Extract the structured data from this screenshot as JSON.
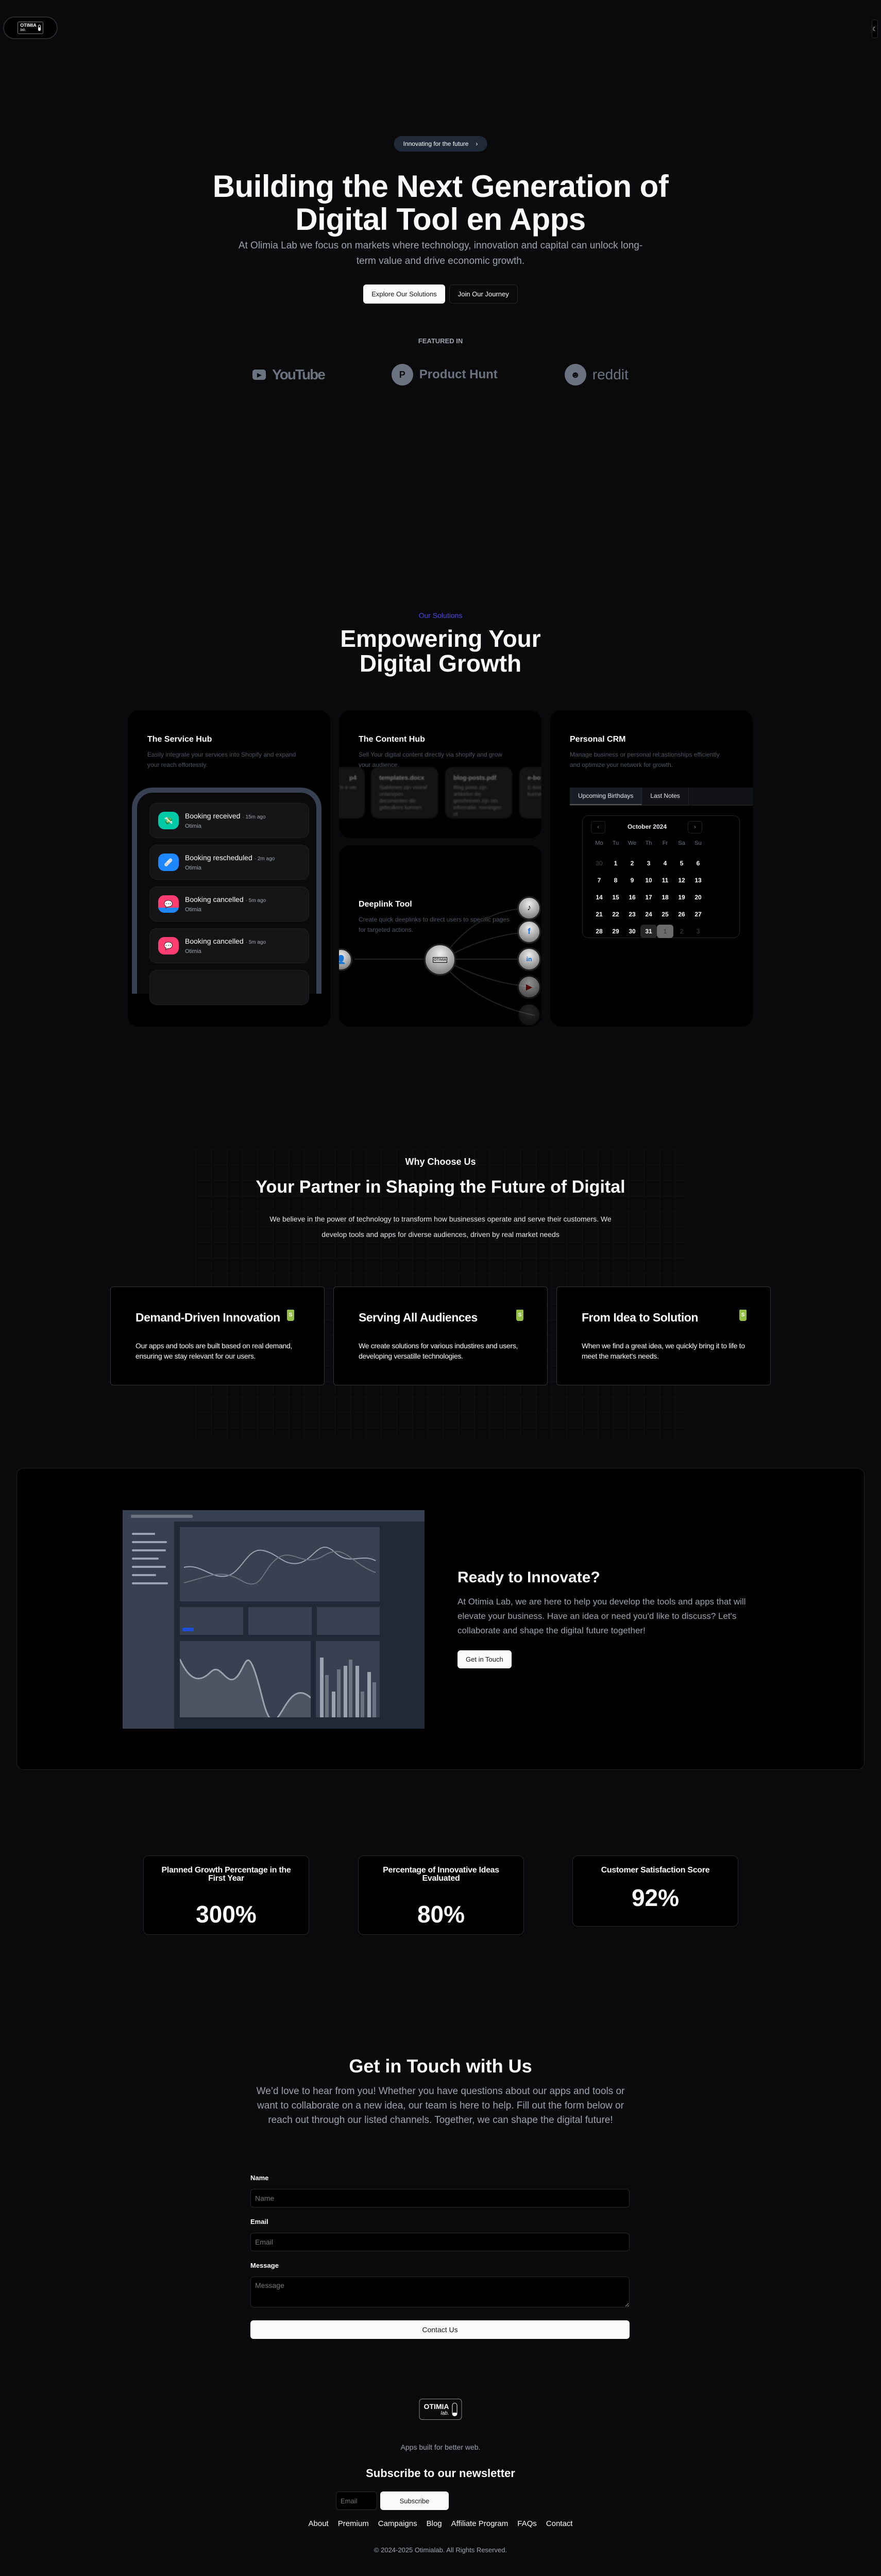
{
  "header": {
    "logo_main": "OTIMIA",
    "logo_sub": "lab.",
    "theme_icon": "moon-icon"
  },
  "hero": {
    "badge": "Innovating for the future",
    "badge_icon": "›",
    "title_line1": "Building the Next Generation of",
    "title_line2": "Digital Tool en Apps",
    "subtitle": "At Olimia Lab we focus on markets where technology, innovation and capital can unlock long-term value and drive economic growth.",
    "primary_button": "Explore Our Solutions",
    "secondary_button": "Join Our Journey",
    "featured_label": "FEATURED IN",
    "featured_logos": [
      "YouTube",
      "Product Hunt",
      "reddit"
    ]
  },
  "solutions": {
    "label": "Our Solutions",
    "title_line1": "Empowering Your",
    "title_line2": "Digital Growth",
    "service_hub": {
      "title": "The Service Hub",
      "desc": "Easily integrate your services into Shopify and expand your reach effortessly.",
      "notifications": [
        {
          "title": "Booking received",
          "time": "· 15m ago",
          "sub": "Otimia",
          "color": "#00c9a7",
          "icon": "💸"
        },
        {
          "title": "Booking rescheduled",
          "time": "· 2m ago",
          "sub": "Otimia",
          "color": "#1e86ff",
          "icon": "🩹"
        },
        {
          "title": "Booking cancelled",
          "time": "· 5m ago",
          "sub": "Otimia",
          "color": "#ff3d71",
          "icon": "💬"
        },
        {
          "title": "Booking cancelled",
          "time": "· 5m ago",
          "sub": "Otimia",
          "color": "#ff3d71",
          "icon": "💬"
        }
      ]
    },
    "content_hub": {
      "title": "The Content Hub",
      "desc": "Sell Your digital content directly via shopify and grow your audience.",
      "files": [
        {
          "name": "p4",
          "desc": "ls e ver"
        },
        {
          "name": "templates.docx",
          "desc": "Sjablonen zijn vooraf ontworpen documenten die gebruikers kunnen"
        },
        {
          "name": "blog-posts.pdf",
          "desc": "Blog posts zijn artikelen die geschreven zijn om informatie, meningen of"
        },
        {
          "name": "e-bo",
          "desc": "E-boo digita die g kunne"
        }
      ]
    },
    "deeplink": {
      "title": "Deeplink Tool",
      "desc": "Create quick deeplinks to direct users to specific pages for targeted actions.",
      "targets": [
        "tiktok",
        "facebook",
        "linkedin",
        "youtube",
        "instagram"
      ]
    },
    "crm": {
      "title": "Personal CRM",
      "desc": "Manage business or personal rel;astionships efficiently and optimize your network for growth.",
      "tabs": [
        "Upcoming Birthdays",
        "Last Notes"
      ],
      "calendar": {
        "month": "October 2024",
        "weekdays": [
          "Mo",
          "Tu",
          "We",
          "Th",
          "Fr",
          "Sa",
          "Su"
        ],
        "days": [
          "30",
          "1",
          "2",
          "3",
          "4",
          "5",
          "6",
          "7",
          "8",
          "9",
          "10",
          "11",
          "12",
          "13",
          "14",
          "15",
          "16",
          "17",
          "18",
          "19",
          "20",
          "21",
          "22",
          "23",
          "24",
          "25",
          "26",
          "27",
          "28",
          "29",
          "30",
          "31",
          "1",
          "2",
          "3"
        ],
        "outside_indices": [
          0,
          32,
          33,
          34
        ],
        "today_index": 31,
        "selected_index": 32
      }
    }
  },
  "why": {
    "label": "Why Choose Us",
    "title": "Your Partner in Shaping the Future of Digital",
    "subtitle": "We believe in the power of technology to transform how businesses operate and serve their customers. We develop tools and apps for diverse audiences, driven by real market needs",
    "features": [
      {
        "title": "Demand-Driven Innovation",
        "text": "Our apps and tools are built based on real demand, ensuring we stay relevant for our users."
      },
      {
        "title": "Serving All Audiences",
        "text": "We create solutions for various industires and users, developing versatille technologies."
      },
      {
        "title": "From Idea to Solution",
        "text": "When we find a great idea, we quickly bring it to life to meet the market's needs."
      }
    ]
  },
  "cta": {
    "title": "Ready to Innovate?",
    "text": "At Otimia Lab, we are here to help you develop the tools and apps that will elevate your business. Have an idea or need you'd like to discuss? Let's collaborate and shape the digital future together!",
    "button": "Get in Touch"
  },
  "stats": [
    {
      "label": "Planned Growth Percentage in the First Year",
      "value": "300%"
    },
    {
      "label": "Percentage of Innovative Ideas Evaluated",
      "value": "80%"
    },
    {
      "label": "Customer Satisfaction Score",
      "value": "92%"
    }
  ],
  "contact": {
    "title": "Get in Touch with Us",
    "subtitle": "We’d love to hear from you! Whether you have questions about our apps and tools or want to collaborate on a new idea, our team is here to help. Fill out the form below or reach out through our listed channels. Together, we can shape the digital future!",
    "name_label": "Name",
    "name_placeholder": "Name",
    "email_label": "Email",
    "email_placeholder": "Email",
    "message_label": "Message",
    "message_placeholder": "Message",
    "submit": "Contact Us"
  },
  "footer": {
    "logo_main": "OTIMIA",
    "logo_sub": "lab.",
    "tagline": "Apps built for better web.",
    "newsletter_title": "Subscribe to our newsletter",
    "email_placeholder": "Email",
    "subscribe": "Subscribe",
    "links": [
      "About",
      "Premium",
      "Campaigns",
      "Blog",
      "Affiliate Program",
      "FAQs",
      "Contact"
    ],
    "copyright": "© 2024-2025 Otimialab. All Rights Reserved."
  }
}
